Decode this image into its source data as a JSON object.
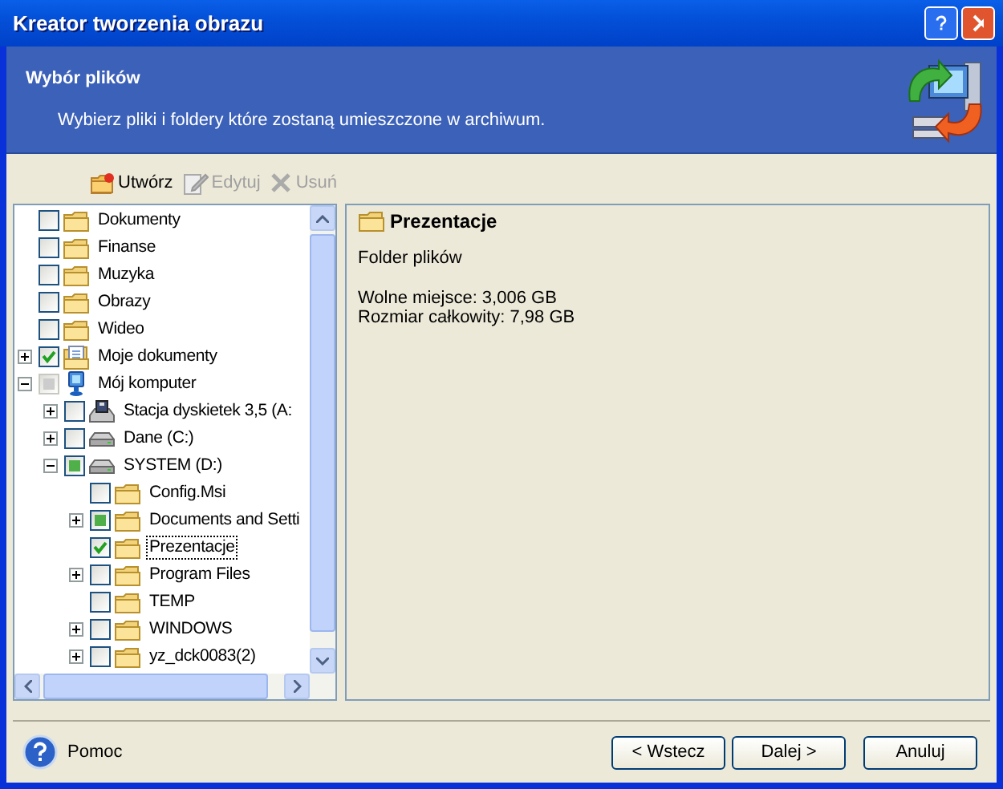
{
  "window": {
    "title": "Kreator tworzenia obrazu"
  },
  "header": {
    "title": "Wybór plików",
    "subtitle": "Wybierz pliki i foldery które zostaną umieszczone w archiwum."
  },
  "toolbar": [
    {
      "kind": "new",
      "label": "Utwórz",
      "disabled": false
    },
    {
      "kind": "edit",
      "label": "Edytuj",
      "disabled": true
    },
    {
      "kind": "delete",
      "label": "Usuń",
      "disabled": true
    }
  ],
  "tree": [
    {
      "kind": "folder",
      "label": "Dokumenty",
      "checked": false,
      "mixed": false,
      "disabled": false,
      "selected": false
    },
    {
      "kind": "folder",
      "label": "Finanse",
      "checked": false,
      "mixed": false,
      "disabled": false,
      "selected": false
    },
    {
      "kind": "folder",
      "label": "Muzyka",
      "checked": false,
      "mixed": false,
      "disabled": false,
      "selected": false
    },
    {
      "kind": "folder",
      "label": "Obrazy",
      "checked": false,
      "mixed": false,
      "disabled": false,
      "selected": false
    },
    {
      "kind": "folder",
      "label": "Wideo",
      "checked": false,
      "mixed": false,
      "disabled": false,
      "selected": false
    },
    {
      "kind": "document",
      "label": "Moje dokumenty",
      "checked": true,
      "mixed": false,
      "disabled": false,
      "expanded": false,
      "selected": false
    },
    {
      "kind": "computer",
      "label": "Mój komputer",
      "checked": false,
      "mixed": true,
      "disabled": true,
      "expanded": true,
      "selected": false,
      "children": [
        {
          "kind": "floppy",
          "label": "Stacja dyskietek 3,5 (A:",
          "checked": false,
          "mixed": false,
          "disabled": false,
          "expanded": false,
          "selected": false
        },
        {
          "kind": "drive",
          "label": "Dane (C:)",
          "checked": false,
          "mixed": false,
          "disabled": false,
          "expanded": false,
          "selected": false
        },
        {
          "kind": "drive",
          "label": "SYSTEM (D:)",
          "checked": false,
          "mixed": true,
          "disabled": false,
          "expanded": true,
          "selected": false,
          "children": [
            {
              "kind": "folder",
              "label": "Config.Msi",
              "checked": false,
              "mixed": false,
              "disabled": false,
              "selected": false
            },
            {
              "kind": "folder",
              "label": "Documents and Setti",
              "checked": false,
              "mixed": true,
              "disabled": false,
              "expanded": false,
              "selected": false
            },
            {
              "kind": "folder",
              "label": "Prezentacje",
              "checked": true,
              "mixed": false,
              "disabled": false,
              "selected": true
            },
            {
              "kind": "folder",
              "label": "Program Files",
              "checked": false,
              "mixed": false,
              "disabled": false,
              "expanded": false,
              "selected": false
            },
            {
              "kind": "folder",
              "label": "TEMP",
              "checked": false,
              "mixed": false,
              "disabled": false,
              "selected": false
            },
            {
              "kind": "folder",
              "label": "WINDOWS",
              "checked": false,
              "mixed": false,
              "disabled": false,
              "expanded": false,
              "selected": false
            },
            {
              "kind": "folder",
              "label": "yz_dck0083(2)",
              "checked": false,
              "mixed": false,
              "disabled": false,
              "expanded": false,
              "selected": false
            }
          ]
        }
      ]
    }
  ],
  "details": {
    "name": "Prezentacje",
    "type": "Folder plików",
    "free_space": "Wolne miejsce: 3,006 GB",
    "total_size": "Rozmiar całkowity: 7,98 GB"
  },
  "footer": {
    "help": "Pomoc",
    "buttons": [
      {
        "label": "< Wstecz"
      },
      {
        "label": "Dalej >"
      },
      {
        "label": "Anuluj"
      }
    ]
  }
}
